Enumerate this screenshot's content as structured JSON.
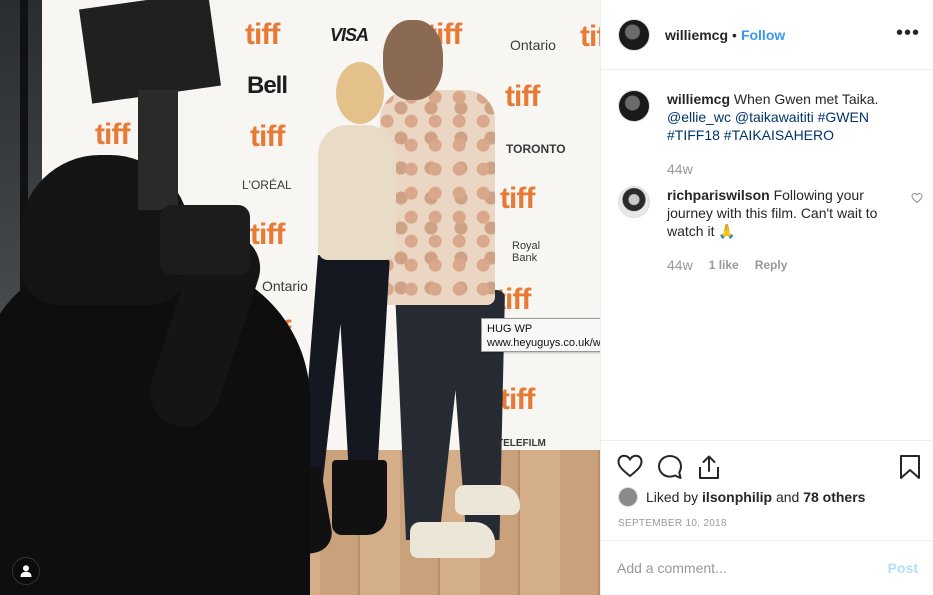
{
  "photo": {
    "tooltip": {
      "title": "HUG WP",
      "url": "www.heyuguys.co.uk/wp-login.php?redirect_t..."
    },
    "backdrop_logos": {
      "tiff": "tiff",
      "visa": "VISA",
      "bell": "Bell",
      "ontario": "Ontario",
      "loreal": "L'ORÉAL",
      "toronto": "TORONTO",
      "royal_bank": "Royal Bank",
      "telefilm": "TELEFILM"
    },
    "user_tag_icon": "person-icon"
  },
  "post": {
    "author": "williemcg",
    "separator": "•",
    "follow_label": "Follow",
    "more_icon": "ellipsis-icon",
    "more_label": "•••",
    "caption": {
      "username": "williemcg",
      "text": "When Gwen met Taika.",
      "mention1": "@ellie_wc",
      "mention2": "@taikawaititi",
      "tag1": "#GWEN",
      "tag2": "#TIFF18",
      "tag3": "#TAIKAISAHERO",
      "age": "44w"
    },
    "comment": {
      "username": "richpariswilson",
      "text": "Following your journey with this film. Can't wait to watch it 🙏",
      "age": "44w",
      "likes": "1 like",
      "reply_label": "Reply"
    },
    "likes": {
      "prefix": "Liked by",
      "user": "ilsonphilip",
      "joiner": "and",
      "others": "78 others"
    },
    "date": "SEPTEMBER 10, 2018",
    "add_comment_placeholder": "Add a comment...",
    "post_label": "Post",
    "icons": [
      "heart-icon",
      "comment-icon",
      "share-icon",
      "bookmark-icon"
    ]
  },
  "colors": {
    "link_blue": "#3897f0",
    "tag_blue": "#003569",
    "muted": "#999999",
    "post_disabled": "#b2dffc"
  }
}
